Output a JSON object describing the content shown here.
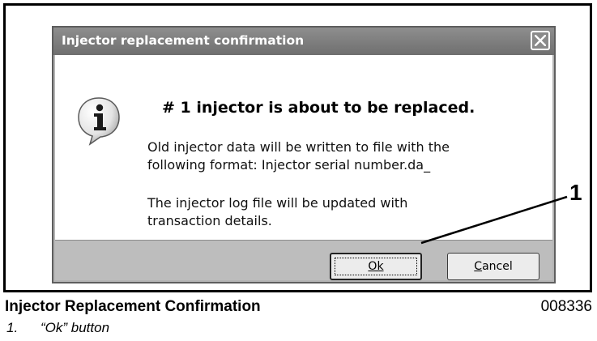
{
  "dialog": {
    "title": "Injector replacement confirmation",
    "icon": "info-icon",
    "heading": "# 1 injector is about to be replaced.",
    "paragraph1_line1": "Old injector data will be written to file with the",
    "paragraph1_line2": "following format: Injector serial number.da_",
    "paragraph2_line1": "The injector log file will be updated with",
    "paragraph2_line2": "transaction details.",
    "ok_label": "Ok",
    "cancel_label": "Cancel"
  },
  "callout": {
    "number": "1"
  },
  "caption": {
    "title": "Injector Replacement Confirmation",
    "code": "008336",
    "item_number": "1.",
    "item_text": "“Ok” button"
  }
}
